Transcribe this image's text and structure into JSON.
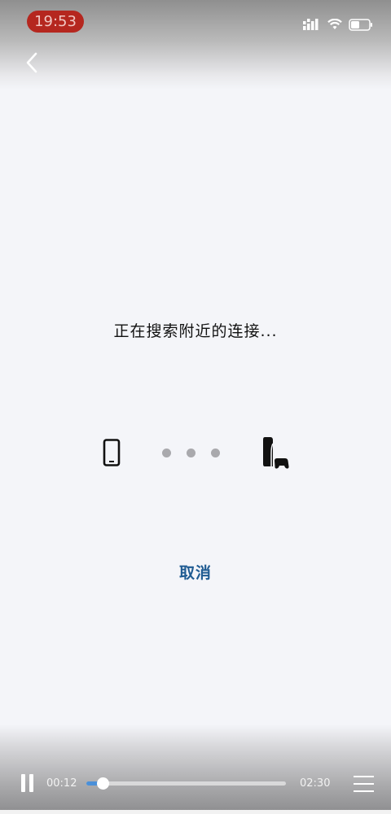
{
  "status_bar": {
    "time": "19:53",
    "time_pill_color": "#b5271f",
    "icons": [
      "signal-icon",
      "wifi-icon",
      "battery-icon"
    ]
  },
  "nav": {
    "back_icon": "chevron-left-icon"
  },
  "main": {
    "searching_text": "正在搜索附近的连接...",
    "left_device_icon": "smartphone-icon",
    "right_device_icon": "ps5-console-icon",
    "cancel_label": "取消",
    "cancel_color": "#1f5b92"
  },
  "player": {
    "current_time": "00:12",
    "total_time": "02:30",
    "progress_fraction": 0.08,
    "progress_color": "#4a90d9",
    "pause_icon": "pause-icon",
    "menu_icon": "menu-icon"
  }
}
